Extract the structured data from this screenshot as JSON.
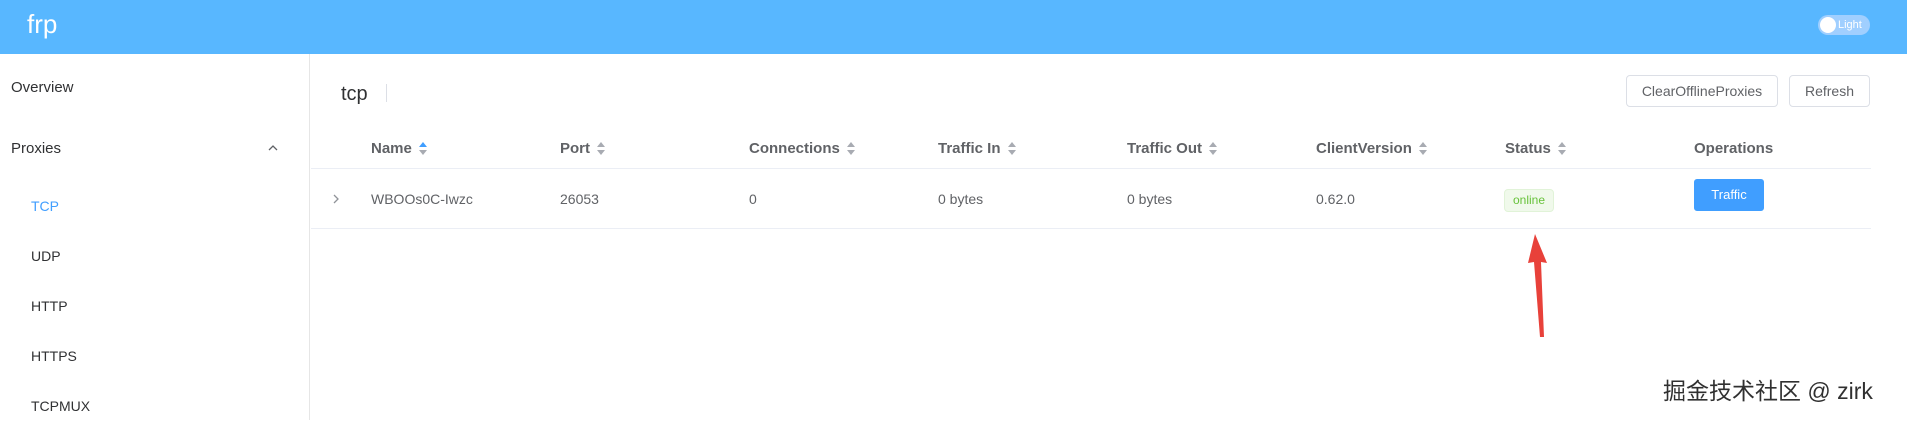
{
  "header": {
    "brand": "frp",
    "theme_toggle_label": "Light",
    "bg_color": "#58b7ff"
  },
  "sidebar": {
    "items": [
      {
        "label": "Overview",
        "type": "top"
      },
      {
        "label": "Proxies",
        "type": "top",
        "expanded": true,
        "icon": "chevron-up-icon"
      },
      {
        "label": "TCP",
        "type": "sub",
        "active": true
      },
      {
        "label": "UDP",
        "type": "sub"
      },
      {
        "label": "HTTP",
        "type": "sub"
      },
      {
        "label": "HTTPS",
        "type": "sub"
      },
      {
        "label": "TCPMUX",
        "type": "sub"
      }
    ]
  },
  "main": {
    "title": "tcp",
    "actions": {
      "clear_label": "ClearOfflineProxies",
      "refresh_label": "Refresh"
    },
    "table": {
      "columns": [
        "Name",
        "Port",
        "Connections",
        "Traffic In",
        "Traffic Out",
        "ClientVersion",
        "Status",
        "Operations"
      ],
      "sorted_column": "Name",
      "sort_direction": "ascending",
      "rows": [
        {
          "name": "WBOOs0C-Iwzc",
          "port": "26053",
          "connections": "0",
          "traffic_in": "0 bytes",
          "traffic_out": "0 bytes",
          "client_version": "0.62.0",
          "status": "online",
          "operation_label": "Traffic"
        }
      ]
    }
  },
  "annotation": {
    "arrow_color": "#e8413a",
    "points_to": "status-tag"
  },
  "watermark": "掘金技术社区 @ zirk",
  "colors": {
    "accent": "#409eff",
    "online_text": "#67c23a",
    "online_bg": "#f0f9eb"
  }
}
